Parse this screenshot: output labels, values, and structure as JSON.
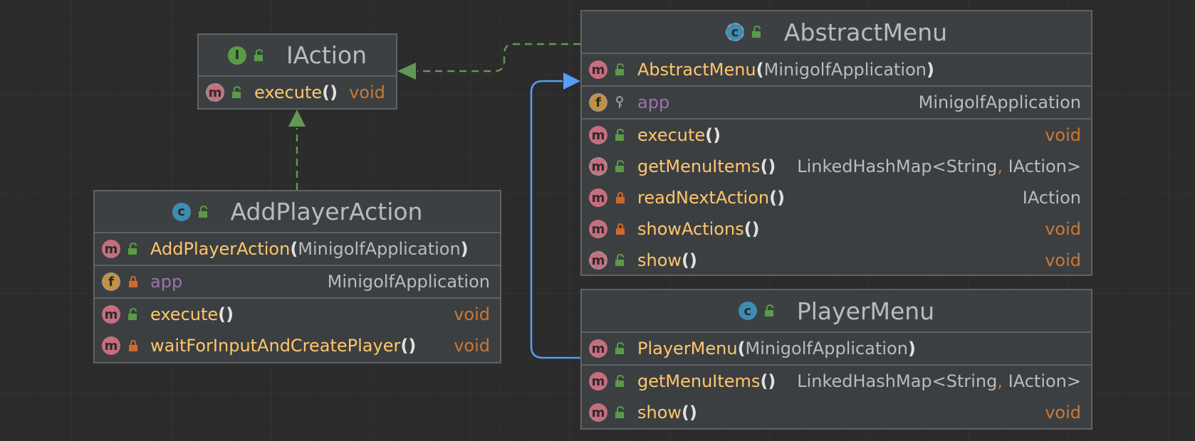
{
  "colors": {
    "background": "#2b2b2b",
    "box_fill": "#3c3f41",
    "box_border": "#5f6265",
    "method_badge": "#c76e7e",
    "field_badge": "#c39042",
    "class_badge": "#3d8cb3",
    "interface_badge": "#5a9b45",
    "method_name": "#ffc66d",
    "field_name": "#9876aa",
    "void_type": "#cc7832",
    "implements_arrow": "#629755",
    "extends_arrow": "#589df6"
  },
  "classes": {
    "iaction": {
      "title": "IAction",
      "kind_badge": "I",
      "methods": [
        {
          "badge": "m",
          "name": "execute",
          "params": "",
          "return": "void"
        }
      ]
    },
    "abstract_menu": {
      "title": "AbstractMenu",
      "kind_badge": "c",
      "constructor": {
        "badge": "m",
        "name": "AbstractMenu",
        "params": "MinigolfApplication"
      },
      "field": {
        "badge": "f",
        "name": "app",
        "type": "MinigolfApplication"
      },
      "methods": [
        {
          "badge": "m",
          "name": "execute",
          "return": "void"
        },
        {
          "badge": "m",
          "name": "getMenuItems",
          "return_a": "LinkedHashMap<String",
          "return_sep": ",",
          "return_b": " IAction>"
        },
        {
          "badge": "m",
          "name": "readNextAction",
          "return": "IAction"
        },
        {
          "badge": "m",
          "name": "showActions",
          "return": "void"
        },
        {
          "badge": "m",
          "name": "show",
          "return": "void"
        }
      ]
    },
    "add_player_action": {
      "title": "AddPlayerAction",
      "kind_badge": "c",
      "constructor": {
        "badge": "m",
        "name": "AddPlayerAction",
        "params": "MinigolfApplication"
      },
      "field": {
        "badge": "f",
        "name": "app",
        "type": "MinigolfApplication"
      },
      "methods": [
        {
          "badge": "m",
          "name": "execute",
          "return": "void"
        },
        {
          "badge": "m",
          "name": "waitForInputAndCreatePlayer",
          "return": "void"
        }
      ]
    },
    "player_menu": {
      "title": "PlayerMenu",
      "kind_badge": "c",
      "constructor": {
        "badge": "m",
        "name": "PlayerMenu",
        "params": "MinigolfApplication"
      },
      "methods": [
        {
          "badge": "m",
          "name": "getMenuItems",
          "return_a": "LinkedHashMap<String",
          "return_sep": ",",
          "return_b": " IAction>"
        },
        {
          "badge": "m",
          "name": "show",
          "return": "void"
        }
      ]
    }
  },
  "punct": {
    "open": "(",
    "close": ")",
    "empty": "()"
  }
}
